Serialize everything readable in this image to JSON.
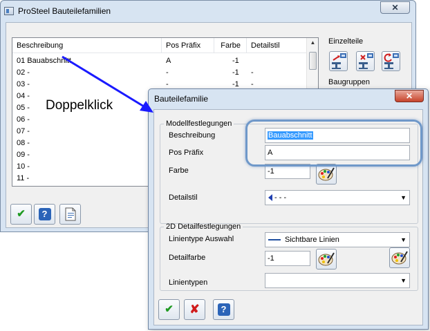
{
  "main_window": {
    "title": "ProSteel Bauteilefamilien",
    "close_glyph": "✕",
    "columns": [
      "Beschreibung",
      "Pos Präfix",
      "Farbe",
      "Detailstil"
    ],
    "rows": [
      {
        "desc": "01 Bauabschnitt",
        "prefix": "A",
        "farbe": "-1",
        "detail": ""
      },
      {
        "desc": "02 -",
        "prefix": "-",
        "farbe": "-1",
        "detail": "-"
      },
      {
        "desc": "03 -",
        "prefix": "-",
        "farbe": "-1",
        "detail": "-"
      },
      {
        "desc": "04 -",
        "prefix": "",
        "farbe": "",
        "detail": ""
      },
      {
        "desc": "05 -",
        "prefix": "",
        "farbe": "",
        "detail": ""
      },
      {
        "desc": "06 -",
        "prefix": "",
        "farbe": "",
        "detail": ""
      },
      {
        "desc": "07 -",
        "prefix": "",
        "farbe": "",
        "detail": ""
      },
      {
        "desc": "08 -",
        "prefix": "",
        "farbe": "",
        "detail": ""
      },
      {
        "desc": "09 -",
        "prefix": "",
        "farbe": "",
        "detail": ""
      },
      {
        "desc": "10 -",
        "prefix": "",
        "farbe": "",
        "detail": ""
      },
      {
        "desc": "11 -",
        "prefix": "",
        "farbe": "",
        "detail": ""
      }
    ],
    "einzelteile_label": "Einzelteile",
    "baugruppen_label": "Baugruppen",
    "ok_glyph": "✔",
    "help_glyph": "?"
  },
  "dialog": {
    "title": "Bauteilefamilie",
    "close_glyph": "✕",
    "modell_group": "Modellfestlegungen",
    "beschreibung_label": "Beschreibung",
    "beschreibung_value": "Bauabschnitt",
    "pos_prefix_label": "Pos Präfix",
    "pos_prefix_value": "A",
    "farbe_label": "Farbe",
    "farbe_value": "-1",
    "detailstil_label": "Detailstil",
    "detailstil_value": "- - -",
    "detail_group": "2D Detailfestlegungen",
    "linientype_label": "Linientype Auswahl",
    "linientype_value": "Sichtbare Linien",
    "detailfarbe_label": "Detailfarbe",
    "detailfarbe_value": "-1",
    "linientypen_label": "Linientypen",
    "linientypen_value": "",
    "ok_glyph": "✔",
    "cancel_glyph": "✘",
    "help_glyph": "?"
  },
  "annotation": {
    "text": "Doppelklick",
    "arrow_color": "#1a1aff",
    "highlight_color": "#6f98c9"
  }
}
